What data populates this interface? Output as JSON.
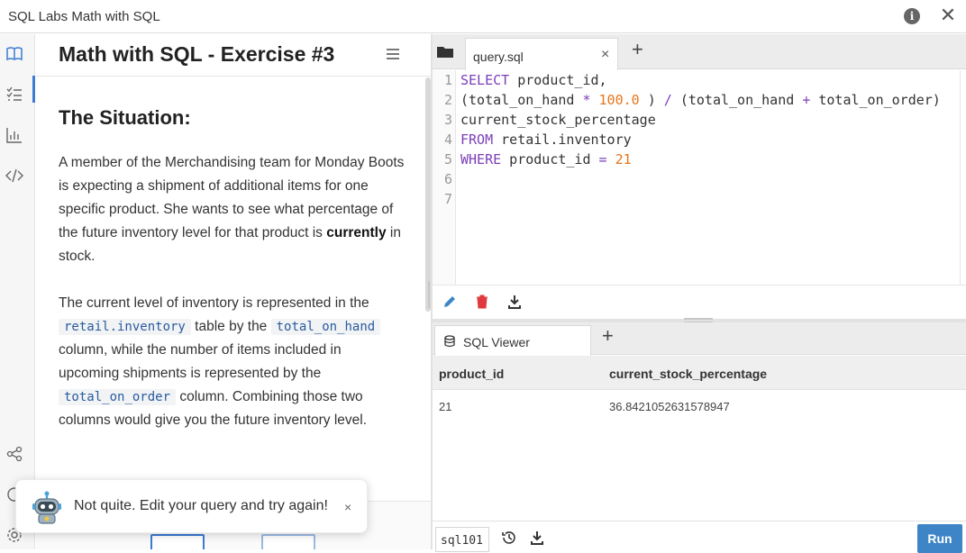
{
  "window": {
    "title": "SQL Labs Math with SQL"
  },
  "lesson": {
    "title": "Math with SQL - Exercise #3",
    "heading": "The Situation:",
    "p1": {
      "before": "A member of the Merchandising team for Monday Boots is expecting a shipment of additional items for one specific product. She wants to see what percentage of the future inventory level for that product is ",
      "bold": "currently",
      "after": " in stock."
    },
    "p2": {
      "t1": "The current level of inventory is represented in the ",
      "code1": "retail.inventory",
      "t2": " table by the ",
      "code2": "total_on_hand",
      "t3": " column, while the number of items included in upcoming shipments is represented by the ",
      "code3": "total_on_order",
      "t4": " column. Combining those two columns would give you the future inventory level."
    }
  },
  "toast": {
    "message": "Not quite. Edit your query and try again!",
    "close": "×"
  },
  "editor": {
    "tab_label": "query.sql",
    "tab_close": "×",
    "add_tab": "+",
    "line_numbers": [
      "1",
      "2",
      "3",
      "4",
      "5",
      "6",
      "7"
    ],
    "lines": {
      "l1_kw": "SELECT",
      "l1_rest": " product_id,",
      "l2_a": "(total_on_hand ",
      "l2_op1": "*",
      "l2_b": " ",
      "l2_num": "100.0",
      "l2_c": " ) ",
      "l2_op2": "/",
      "l2_d": " (total_on_hand ",
      "l2_op3": "+",
      "l2_e": " total_on_order)",
      "l3": "current_stock_percentage",
      "l4_kw": "FROM",
      "l4_rest": " retail.inventory",
      "l5_kw": "WHERE",
      "l5_a": " product_id ",
      "l5_op": "=",
      "l5_b": " ",
      "l5_num": "21"
    }
  },
  "results": {
    "tab_label": "SQL Viewer",
    "add_tab": "+",
    "columns": [
      "product_id",
      "current_stock_percentage"
    ],
    "rows": [
      [
        "21",
        "36.8421052631578947"
      ]
    ]
  },
  "statusbar": {
    "database": "sql101",
    "run_label": "Run"
  },
  "colors": {
    "accent": "#3d85c6",
    "keyword": "#7b3fb8",
    "number": "#e8751a",
    "delete": "#e0393e"
  },
  "icons": {
    "rail": [
      "book-icon",
      "checklist-icon",
      "bar-chart-icon",
      "code-icon",
      "share-icon",
      "help-icon",
      "settings-icon"
    ],
    "toolbar": [
      "pencil-icon",
      "trash-icon",
      "download-icon"
    ]
  }
}
